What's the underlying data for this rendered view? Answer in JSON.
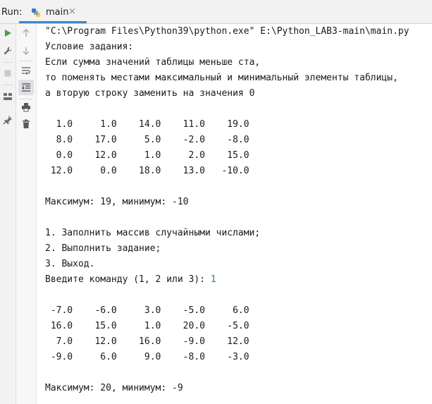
{
  "header": {
    "run_label": "Run:",
    "tab_title": "main",
    "tab_close": "×",
    "tab_icon": "python-file-icon"
  },
  "toolbar": {
    "icons": [
      "run-icon",
      "wrench-icon",
      "stop-icon",
      "layout-icon",
      "pin-icon",
      "up-arrow-icon",
      "down-arrow-icon",
      "soft-wrap-icon",
      "scroll-to-end-icon",
      "print-icon",
      "delete-icon"
    ]
  },
  "console": {
    "lines": [
      "\"C:\\Program Files\\Python39\\python.exe\" E:\\Python_LAB3-main\\main.py",
      "Условие задания:",
      "Если сумма значений таблицы меньше ста,",
      "то поменять местами максимальный и минимальный элементы таблицы,",
      "а вторую строку заменить на значения 0",
      "",
      "  1.0     1.0    14.0    11.0    19.0",
      "  8.0    17.0     5.0    -2.0    -8.0",
      "  0.0    12.0     1.0     2.0    15.0",
      " 12.0     0.0    18.0    13.0   -10.0",
      "",
      "Максимум: 19, минимум: -10",
      "",
      "1. Заполнить массив случайными числами;",
      "2. Выполнить задание;",
      "3. Выход.",
      "Введите команду (1, 2 или 3): ",
      "",
      " -7.0    -6.0     3.0    -5.0     6.0",
      " 16.0    15.0     1.0    20.0    -5.0",
      "  7.0    12.0    16.0    -9.0    12.0",
      " -9.0     6.0     9.0    -8.0    -3.0",
      "",
      "Максимум: 20, минимум: -9"
    ],
    "input_value": "1"
  },
  "colors": {
    "accent": "#4083c9",
    "run_green": "#499c54",
    "input_green": "#15965f"
  }
}
